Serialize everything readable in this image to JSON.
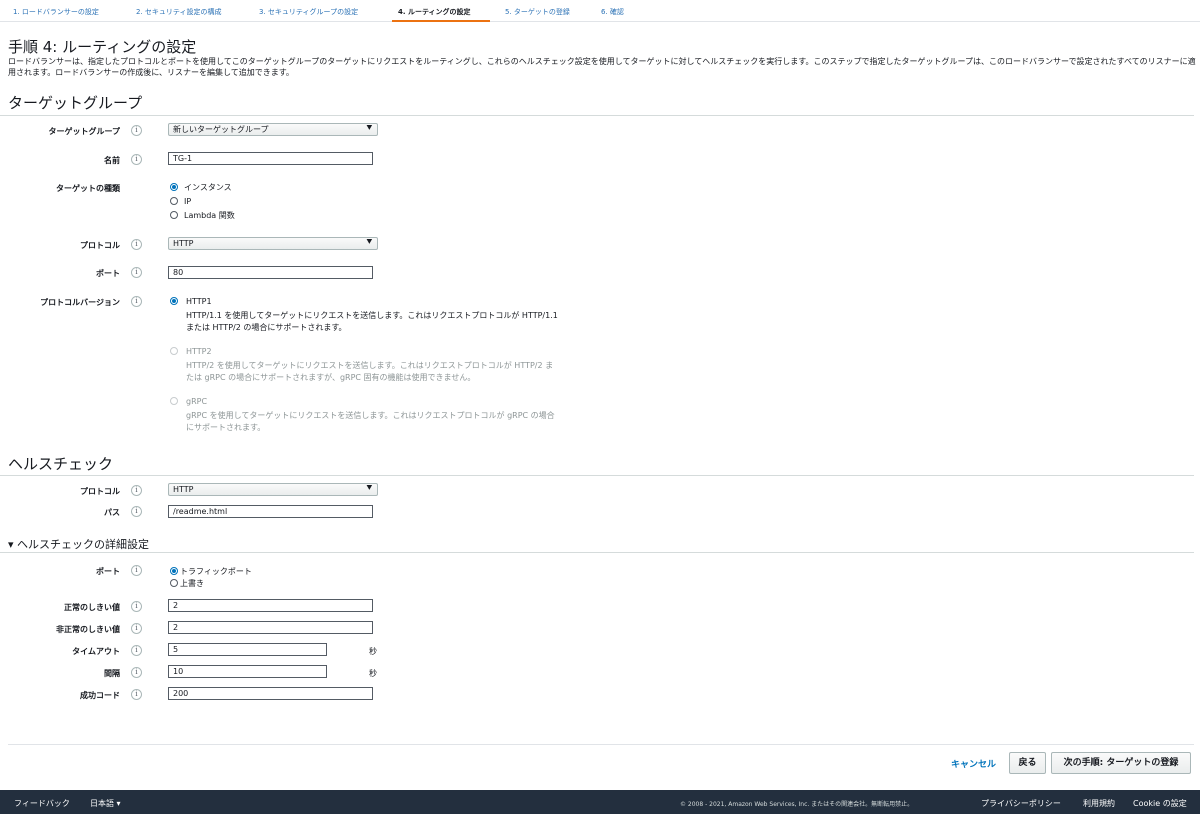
{
  "steps": [
    "1. ロードバランサーの設定",
    "2. セキュリティ設定の構成",
    "3. セキュリティグループの設定",
    "4. ルーティングの設定",
    "5. ターゲットの登録",
    "6. 確認"
  ],
  "page": {
    "title": "手順 4: ルーティングの設定",
    "description": "ロードバランサーは、指定したプロトコルとポートを使用してこのターゲットグループのターゲットにリクエストをルーティングし、これらのヘルスチェック設定を使用してターゲットに対してヘルスチェックを実行します。このステップで指定したターゲットグループは、このロードバランサーで設定されたすべてのリスナーに適用されます。ロードバランサーの作成後に、リスナーを編集して追加できます。"
  },
  "target_group": {
    "section_title": "ターゲットグループ",
    "tg_label": "ターゲットグループ",
    "tg_value": "新しいターゲットグループ",
    "name_label": "名前",
    "name_value": "TG-1",
    "type_label": "ターゲットの種類",
    "type_options": [
      "インスタンス",
      "IP",
      "Lambda 関数"
    ],
    "protocol_label": "プロトコル",
    "protocol_value": "HTTP",
    "port_label": "ポート",
    "port_value": "80",
    "pv_label": "プロトコルバージョン",
    "pv_options": [
      {
        "title": "HTTP1",
        "desc1": "HTTP/1.1 を使用してターゲットにリクエストを送信します。これはリクエストプロトコルが HTTP/1.1",
        "desc2": "または HTTP/2 の場合にサポートされます。"
      },
      {
        "title": "HTTP2",
        "desc1": "HTTP/2 を使用してターゲットにリクエストを送信します。これはリクエストプロトコルが HTTP/2 ま",
        "desc2": "たは gRPC の場合にサポートされますが、gRPC 固有の機能は使用できません。"
      },
      {
        "title": "gRPC",
        "desc1": "gRPC を使用してターゲットにリクエストを送信します。これはリクエストプロトコルが gRPC の場合",
        "desc2": "にサポートされます。"
      }
    ]
  },
  "health_check": {
    "section_title": "ヘルスチェック",
    "protocol_label": "プロトコル",
    "protocol_value": "HTTP",
    "path_label": "パス",
    "path_value": "/readme.html"
  },
  "advanced": {
    "section_title": "▾ ヘルスチェックの詳細設定",
    "port_label": "ポート",
    "port_options": [
      "トラフィックポート",
      "上書き"
    ],
    "healthy_label": "正常のしきい値",
    "healthy_value": "2",
    "unhealthy_label": "非正常のしきい値",
    "unhealthy_value": "2",
    "timeout_label": "タイムアウト",
    "timeout_value": "5",
    "interval_label": "間隔",
    "interval_value": "10",
    "unit": "秒",
    "success_label": "成功コード",
    "success_value": "200"
  },
  "info_icon": "i",
  "actions": {
    "cancel": "キャンセル",
    "back": "戻る",
    "next": "次の手順: ターゲットの登録"
  },
  "footer": {
    "feedback": "フィードバック",
    "language": "日本語 ▾",
    "copyright": "© 2008 - 2021, Amazon Web Services, Inc. またはその関連会社。無断転用禁止。",
    "privacy": "プライバシーポリシー",
    "terms": "利用規約",
    "cookie": "Cookie の設定"
  }
}
